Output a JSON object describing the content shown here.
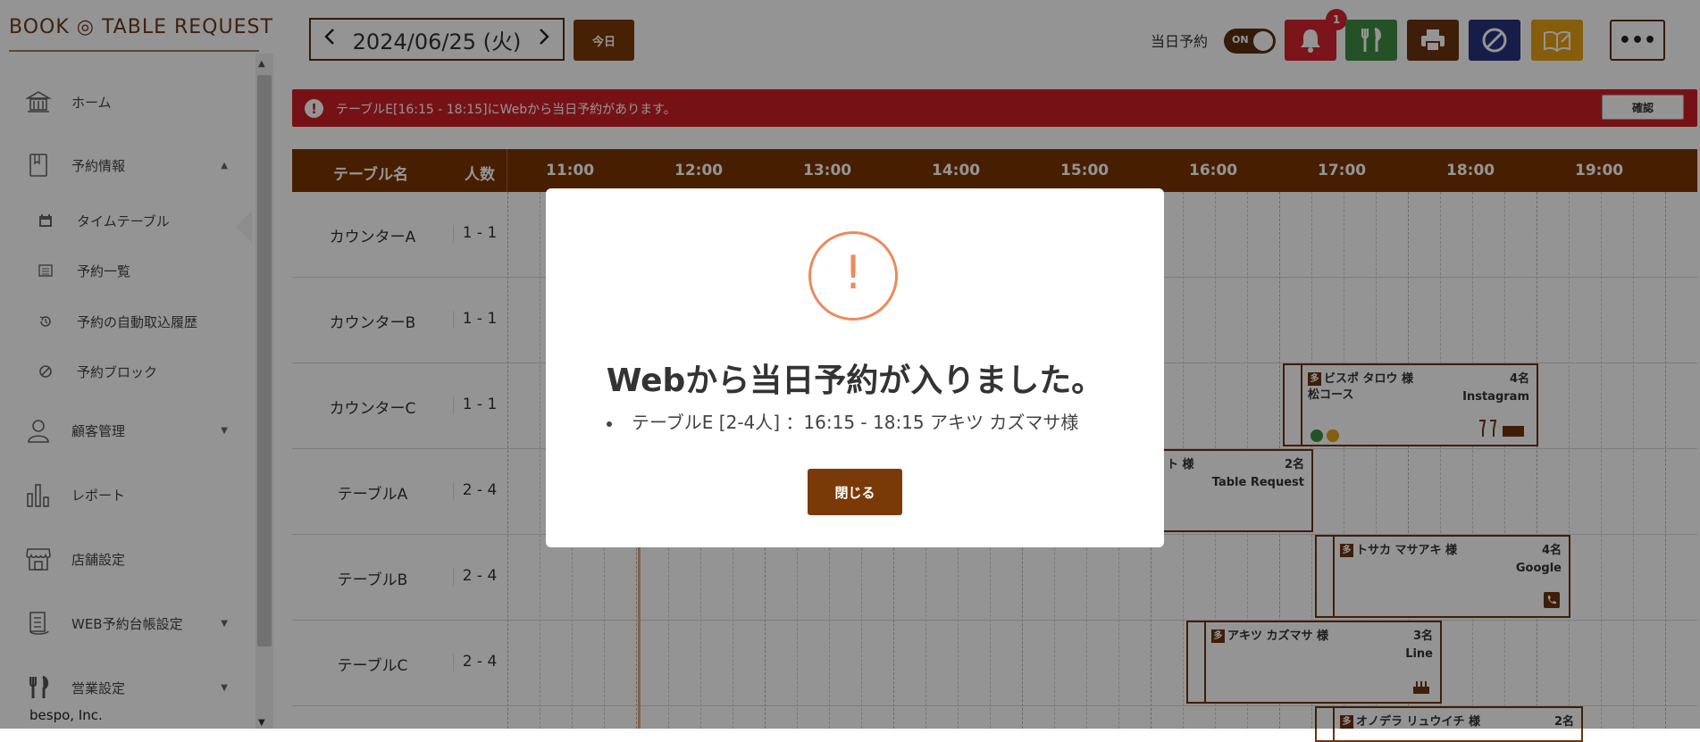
{
  "brand": {
    "logo_text": "BOOK ◎ TABLE REQUEST",
    "company": "bespo, Inc."
  },
  "sidebar": {
    "items": [
      {
        "label": "ホーム"
      },
      {
        "label": "予約情報"
      },
      {
        "label": "タイムテーブル"
      },
      {
        "label": "予約一覧"
      },
      {
        "label": "予約の自動取込履歴"
      },
      {
        "label": "予約ブロック"
      },
      {
        "label": "顧客管理"
      },
      {
        "label": "レポート"
      },
      {
        "label": "店舗設定"
      },
      {
        "label": "WEB予約台帳設定"
      },
      {
        "label": "営業設定"
      }
    ]
  },
  "header": {
    "date": "2024/06/25 (火)",
    "today_button": "今日",
    "same_day_label": "当日予約",
    "toggle_label": "ON",
    "notification_count": "1",
    "more_label": "•••",
    "colors": {
      "bell": "#d6232f",
      "fork": "#3f8d43",
      "print": "#6b3410",
      "block": "#26337f",
      "book": "#e5a013"
    }
  },
  "alert": {
    "icon": "!",
    "message": "テーブルE[16:15 - 18:15]にWebから当日予約があります。",
    "confirm_button": "確認"
  },
  "timetable": {
    "header": {
      "name_col": "テーブル名",
      "cap_col": "人数"
    },
    "hours": [
      "11:00",
      "12:00",
      "13:00",
      "14:00",
      "15:00",
      "16:00",
      "17:00",
      "18:00",
      "19:00"
    ],
    "rows": [
      {
        "name": "カウンターA",
        "cap": "1 - 1"
      },
      {
        "name": "カウンターB",
        "cap": "1 - 1"
      },
      {
        "name": "カウンターC",
        "cap": "1 - 1"
      },
      {
        "name": "テーブルA",
        "cap": "2 - 4"
      },
      {
        "name": "テーブルB",
        "cap": "2 - 4"
      },
      {
        "name": "テーブルC",
        "cap": "2 - 4"
      }
    ],
    "reservations": [
      {
        "tag": "多",
        "name": "ビスポ タロウ 様",
        "people": "4名",
        "course": "松コース",
        "source": "Instagram"
      },
      {
        "tag": "",
        "name": "ト 様",
        "people": "2名",
        "course": "",
        "source": "Table Request"
      },
      {
        "tag": "多",
        "name": "トサカ マサアキ 様",
        "people": "4名",
        "course": "",
        "source": "Google"
      },
      {
        "tag": "多",
        "name": "アキツ カズマサ 様",
        "people": "3名",
        "course": "",
        "source": "Line"
      },
      {
        "tag": "多",
        "name": "オノデラ リュウイチ 様",
        "people": "2名",
        "course": "",
        "source": ""
      }
    ]
  },
  "modal": {
    "icon": "!",
    "title": "Webから当日予約が入りました。",
    "item": "テーブルE [2-4人] ：16:15 - 18:15 アキツ カズマサ様",
    "close_button": "閉じる"
  }
}
